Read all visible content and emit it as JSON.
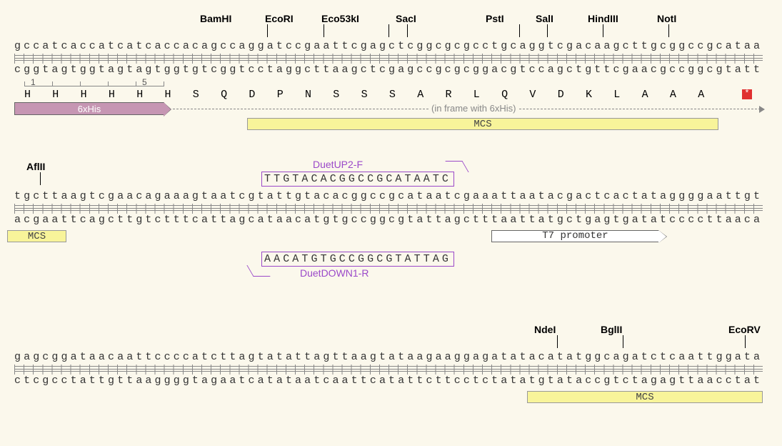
{
  "rows": [
    {
      "top": "gccatcaccatcatcaccacagccaggatccgaattcgagctcggcgcgcctgcaggtcgacaagcttgcggccgcataa",
      "bottom": "cggtagtggtagtagtggtgtcggtcctaggcttaagctcgagccgcgcggacgtccagctgttcgaacgccggcgtatt",
      "enzymes": [
        {
          "name": "BamHI",
          "pos": 27
        },
        {
          "name": "EcoRI",
          "pos": 33
        },
        {
          "name": "Eco53kI",
          "pos": 40
        },
        {
          "name": "SacI",
          "pos": 42
        },
        {
          "name": "PstI",
          "pos": 54
        },
        {
          "name": "SalI",
          "pos": 57
        },
        {
          "name": "HindIII",
          "pos": 63
        },
        {
          "name": "NotI",
          "pos": 70
        }
      ],
      "aa_track": {
        "start": 0,
        "residues": [
          "H",
          "H",
          "H",
          "H",
          "H",
          "H",
          "S",
          "Q",
          "D",
          "P",
          "N",
          "S",
          "S",
          "S",
          "A",
          "R",
          "L",
          "Q",
          "V",
          "D",
          "K",
          "L",
          "A",
          "A",
          "A"
        ],
        "stop_at": 25
      },
      "his_tag": {
        "label": "6xHis",
        "start": 0,
        "end": 6,
        "ruler_labels": [
          "1",
          "5"
        ]
      },
      "mcs": {
        "label": "MCS",
        "start": 25,
        "end": 77
      },
      "frame_label": "(in frame with 6xHis)"
    },
    {
      "top": "tgcttaagtcgaacagaaagtaatcgtattgtacacggccgcataatcgaaattaatacgactcactataggggaattgt",
      "bottom": "acgaattcagcttgtctttcattagcataacatgtgccggcgtattagctttaattatgctgagtgatatccccttaaca",
      "enzymes": [
        {
          "name": "AflII",
          "pos": 3
        }
      ],
      "primer_fwd": {
        "name": "DuetUP2-F",
        "seq": "TTGTACACGGCCGCATAATC",
        "start": 28
      },
      "primer_rev": {
        "name": "DuetDOWN1-R",
        "seq": "AACATGTGCCGGCGTATTAG",
        "start": 28
      },
      "mcs": {
        "label": "MCS",
        "start": 0,
        "end": 6
      },
      "t7": {
        "label": "T7 promoter",
        "start": 51,
        "end": 70
      }
    },
    {
      "top": "gagcggataacaattccccatcttagtatattagttaagtataagaaggagatatacatatggcagatctcaattggata",
      "bottom": "ctcgcctattgttaaggggtagaatcatataatcaattcatattcttcctctatatgtataccgtctagagttaacctat",
      "enzymes": [
        {
          "name": "NdeI",
          "pos": 58
        },
        {
          "name": "BglII",
          "pos": 65
        },
        {
          "name": "EcoRV",
          "pos": 78
        }
      ],
      "mcs": {
        "label": "MCS",
        "start": 55,
        "end": 80
      }
    }
  ],
  "chart_data": {
    "type": "table",
    "title": "DNA sequence map with restriction sites, primers, and features",
    "enzymes": [
      "BamHI",
      "EcoRI",
      "Eco53kI",
      "SacI",
      "PstI",
      "SalI",
      "HindIII",
      "NotI",
      "AflII",
      "NdeI",
      "BglII",
      "EcoRV"
    ],
    "features": [
      "6xHis",
      "MCS",
      "T7 promoter"
    ],
    "primers": [
      {
        "name": "DuetUP2-F",
        "seq": "TTGTACACGGCCGCATAATC",
        "direction": "forward"
      },
      {
        "name": "DuetDOWN1-R",
        "seq": "AACATGTGCCGGCGTATTAG",
        "direction": "reverse"
      }
    ],
    "translation_row1": "H H H H H H S Q D P N S S S A R L Q V D K L A A A *"
  }
}
